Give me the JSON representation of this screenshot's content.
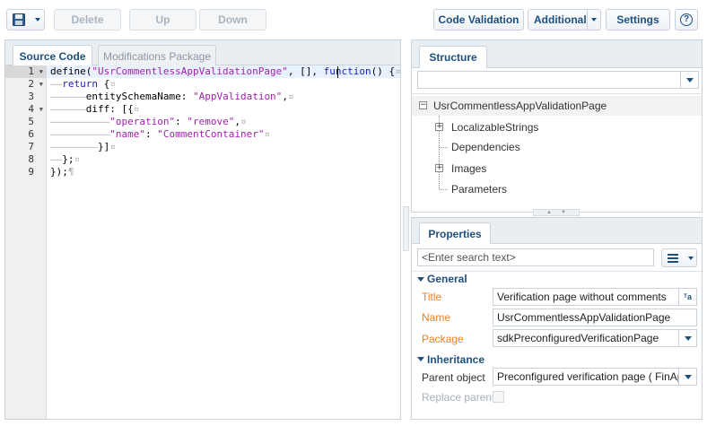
{
  "toolbar": {
    "save_icon": "floppy-disk-icon",
    "delete_label": "Delete",
    "up_label": "Up",
    "down_label": "Down",
    "code_validation_label": "Code Validation",
    "additional_label": "Additional",
    "settings_label": "Settings",
    "help_icon": "question-icon"
  },
  "editor": {
    "tabs": [
      {
        "label": "Source Code",
        "active": true
      },
      {
        "label": "Modifications Package",
        "active": false
      }
    ],
    "lines": [
      {
        "num": "1"
      },
      {
        "num": "2"
      },
      {
        "num": "3"
      },
      {
        "num": "4"
      },
      {
        "num": "5"
      },
      {
        "num": "6"
      },
      {
        "num": "7"
      },
      {
        "num": "8"
      },
      {
        "num": "9"
      }
    ],
    "code": {
      "l1_a": "define(",
      "l1_b": "\"UsrCommentlessAppValidationPage\"",
      "l1_c": ", [], ",
      "l1_d": "function",
      "l1_e": "() {",
      "l2_a": "return",
      "l2_b": " {",
      "l3_a": "entitySchemaName: ",
      "l3_b": "\"AppValidation\"",
      "l3_c": ",",
      "l4_a": "diff: [{",
      "l5_a": "\"operation\"",
      "l5_b": ": ",
      "l5_c": "\"remove\"",
      "l5_d": ",",
      "l6_a": "\"name\"",
      "l6_b": ": ",
      "l6_c": "\"CommentContainer\"",
      "l7_a": "}]",
      "l8_a": "};",
      "l9_a": "});"
    }
  },
  "structure": {
    "tab_label": "Structure",
    "root": "UsrCommentlessAppValidationPage",
    "children": [
      "LocalizableStrings",
      "Dependencies",
      "Images",
      "Parameters"
    ]
  },
  "properties": {
    "tab_label": "Properties",
    "search_placeholder": "<Enter search text>",
    "general_label": "General",
    "title_label": "Title",
    "title_value": "Verification page without comments",
    "name_label": "Name",
    "name_value": "UsrCommentlessAppValidationPage",
    "package_label": "Package",
    "package_value": "sdkPreconfiguredVerificationPage",
    "inheritance_label": "Inheritance",
    "parent_label": "Parent object",
    "parent_value": "Preconfigured verification page ( FinAppL",
    "replace_label": "Replace parent"
  },
  "colors": {
    "accent": "#1d4f80",
    "field_label": "#e5822b",
    "string": "#a31fb0",
    "keyword": "#1c1cb8"
  }
}
